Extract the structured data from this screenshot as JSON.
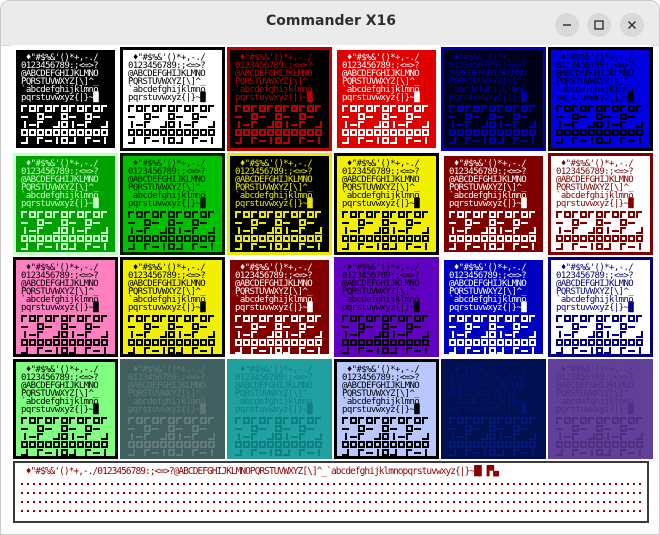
{
  "window": {
    "title": "Commander X16"
  },
  "tiles": [
    {
      "bg": "#000000",
      "fg": "#ffffff",
      "border": "#ffffff"
    },
    {
      "bg": "#ffffff",
      "fg": "#000000",
      "border": "#000000"
    },
    {
      "bg": "#000000",
      "fg": "#c00000",
      "border": "#c00000"
    },
    {
      "bg": "#e00000",
      "fg": "#ffffff",
      "border": "#ffffff"
    },
    {
      "bg": "#000018",
      "fg": "#0000b8",
      "border": "#0000b8"
    },
    {
      "bg": "#0000e0",
      "fg": "#000000",
      "border": "#000000"
    },
    {
      "bg": "#00a000",
      "fg": "#c8ffc8",
      "border": "#c8ffc8"
    },
    {
      "bg": "#00c000",
      "fg": "#002000",
      "border": "#002000"
    },
    {
      "bg": "#000000",
      "fg": "#e8e800",
      "border": "#e8e800"
    },
    {
      "bg": "#f0f000",
      "fg": "#000000",
      "border": "#000000"
    },
    {
      "bg": "#800000",
      "fg": "#ffffff",
      "border": "#ffffff"
    },
    {
      "bg": "#ffffff",
      "fg": "#800000",
      "border": "#800000"
    },
    {
      "bg": "#ff80c0",
      "fg": "#000000",
      "border": "#000000"
    },
    {
      "bg": "#f0f000",
      "fg": "#000000",
      "border": "#000000"
    },
    {
      "bg": "#800000",
      "fg": "#ffffff",
      "border": "#ffffff"
    },
    {
      "bg": "#6000c0",
      "fg": "#000000",
      "border": "#6000c0"
    },
    {
      "bg": "#0000c0",
      "fg": "#ffffff",
      "border": "#ffffff"
    },
    {
      "bg": "#ffffff",
      "fg": "#000080",
      "border": "#000080"
    },
    {
      "bg": "#80ff80",
      "fg": "#000000",
      "border": "#000000"
    },
    {
      "bg": "#406060",
      "fg": "#607878",
      "border": "#406060"
    },
    {
      "bg": "#20a0a0",
      "fg": "#108080",
      "border": "#20a0a0"
    },
    {
      "bg": "#b8c8ff",
      "fg": "#000000",
      "border": "#000000"
    },
    {
      "bg": "#001050",
      "fg": "#001878",
      "border": "#001050"
    },
    {
      "bg": "#604098",
      "fg": "#503080",
      "border": "#604098"
    }
  ],
  "charset_lines": [
    " ♦\"#$%&'()*+,-./",
    "0123456789:;<=>?",
    "@ABCDEFGHIJKLMNO",
    "PQRSTUVWXYZ[\\]^_",
    "`abcdefghijklmno",
    "pqrstuvwxyz{|}~█"
  ],
  "bottom_panel": {
    "text": " ♦\"#$%&'()*+,-./0123456789:;<=>?@ABCDEFGHIJKLMNOPQRSTUVWXYZ[\\]^_`abcdefghijklmnopqrstuvwxyz{|}~█▌▐▀▄",
    "color": "#8b0000"
  }
}
